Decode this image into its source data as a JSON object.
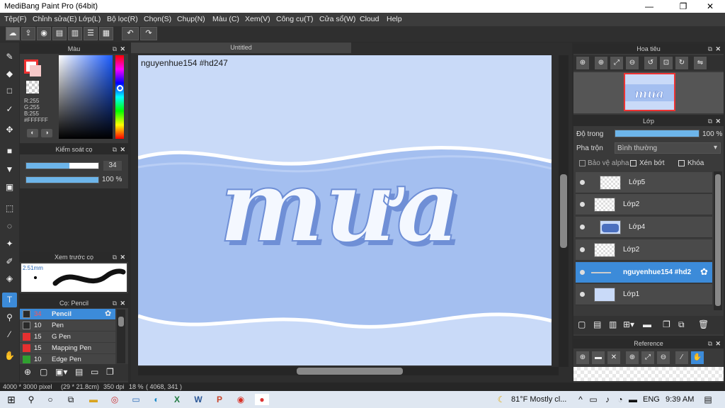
{
  "window": {
    "title": "MediBang Paint Pro (64bit)",
    "minimize": "—",
    "maximize": "❐",
    "close": "✕"
  },
  "menu": [
    "Tệp(F)",
    "Chỉnh sửa(E)",
    "Lớp(L)",
    "Bộ lọc(R)",
    "Chọn(S)",
    "Chụp(N)",
    "Màu (C)",
    "Xem(V)",
    "Công cụ(T)",
    "Cửa sổ(W)",
    "Cloud",
    "Help"
  ],
  "color_panel": {
    "title": "Màu",
    "r": "R:255",
    "g": "G:255",
    "b": "B:255",
    "hex": "#FFFFFF"
  },
  "brush_control": {
    "title": "Kiểm soát cọ",
    "size": "34",
    "opacity": "100 %",
    "size_fraction": 0.6,
    "opacity_fraction": 1.0
  },
  "brush_preview": {
    "title": "Xem trước cọ",
    "size": "2.51mm"
  },
  "brush_list": {
    "title": "Cọ: Pencil",
    "items": [
      {
        "size": "34",
        "name": "Pencil",
        "color": "#2a2a2a",
        "selected": true
      },
      {
        "size": "10",
        "name": "Pen",
        "color": "#2a2a2a",
        "selected": false
      },
      {
        "size": "15",
        "name": "G Pen",
        "color": "#e53030",
        "selected": false
      },
      {
        "size": "15",
        "name": "Mapping Pen",
        "color": "#e53030",
        "selected": false
      },
      {
        "size": "10",
        "name": "Edge Pen",
        "color": "#30a030",
        "selected": false
      }
    ]
  },
  "document": {
    "tab": "Untitled",
    "watermark": "nguyenhue154  #hd247",
    "artwork_text": "mưa"
  },
  "navigator": {
    "title": "Hoa tiêu"
  },
  "layers_panel": {
    "title": "Lớp",
    "opacity_label": "Độ trong",
    "opacity_value": "100 %",
    "opacity_fraction": 1.0,
    "blend_label": "Pha trộn",
    "blend_value": "Bình thường",
    "protect_alpha": "Bảo vệ alpha",
    "clipping": "Xén bớt",
    "lock": "Khóa",
    "layers": [
      {
        "name": "Lớp5",
        "selected": false
      },
      {
        "name": "Lớp2",
        "selected": false
      },
      {
        "name": "Lớp4",
        "selected": false
      },
      {
        "name": "Lớp2",
        "selected": false
      },
      {
        "name": "nguyenhue154  #hd2",
        "selected": true
      },
      {
        "name": "Lớp1",
        "selected": false
      }
    ]
  },
  "reference": {
    "title": "Reference"
  },
  "status": {
    "size": "4000 * 3000 pixel",
    "cm": "(29 * 21.8cm)",
    "dpi": "350 dpi",
    "zoom": "18 %",
    "coords": "( 4068, 341 )"
  },
  "taskbar": {
    "weather": "81°F  Mostly cl...",
    "lang": "ENG",
    "time": "9:39 AM"
  }
}
